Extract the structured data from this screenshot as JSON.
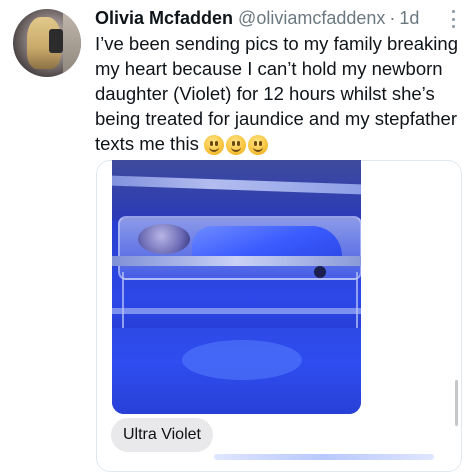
{
  "tweet": {
    "author_name": "Olivia Mcfadden",
    "handle": "@oliviamcfaddenx",
    "separator": "·",
    "time": "1d",
    "text": "I’ve been sending pics to my family breaking my heart because I can’t hold my newborn daughter (Violet) for 12 hours whilst she’s being treated for jaundice and my stepfather texts me this"
  },
  "icons": {
    "more": "more-options-icon",
    "emoji": "slightly-smiling-face-emoji"
  },
  "media": {
    "message_bubble": "Ultra Violet"
  },
  "colors": {
    "text": "#0f1419",
    "secondary_text": "#6b7880",
    "bubble_bg": "#e9e9eb",
    "photo_blue": "#2d48e8"
  }
}
